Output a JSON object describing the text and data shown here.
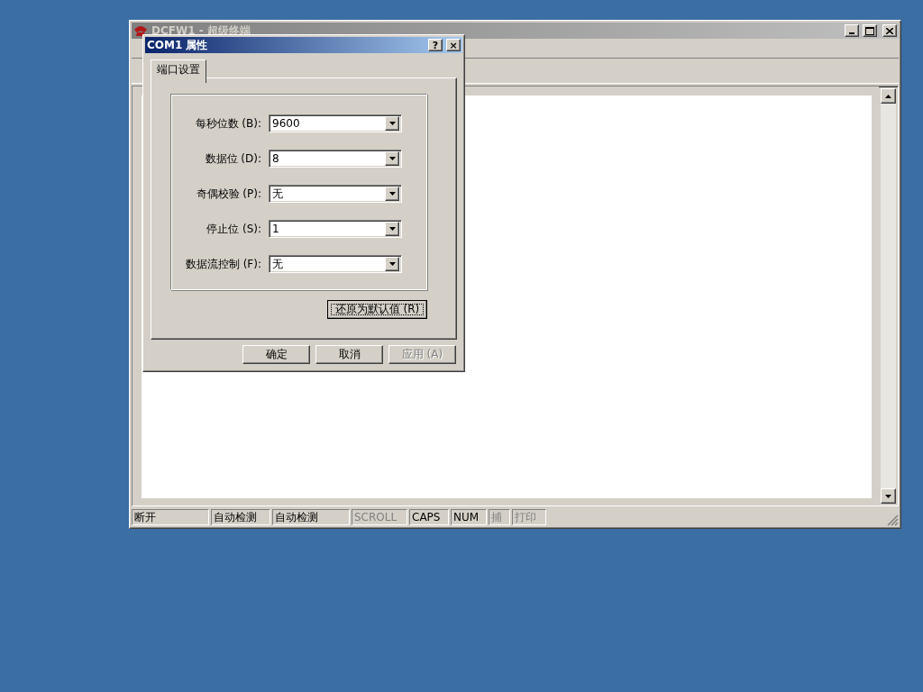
{
  "main_window": {
    "title": "DCFW1 - 超级终端",
    "active": false
  },
  "status_bar": [
    {
      "text": "断开",
      "disabled": false
    },
    {
      "text": "自动检测",
      "disabled": false
    },
    {
      "text": "自动检测",
      "disabled": false
    },
    {
      "text": "SCROLL",
      "disabled": true
    },
    {
      "text": "CAPS",
      "disabled": false
    },
    {
      "text": "NUM",
      "disabled": false
    },
    {
      "text": "捕",
      "disabled": true
    },
    {
      "text": "打印",
      "disabled": true
    }
  ],
  "dialog": {
    "title": "COM1 属性",
    "help_button": "?",
    "close_button": "×",
    "tabs": [
      {
        "label": "端口设置",
        "selected": true
      }
    ],
    "fields": [
      {
        "label": "每秒位数 (B):",
        "value": "9600"
      },
      {
        "label": "数据位 (D):",
        "value": "8"
      },
      {
        "label": "奇偶校验 (P):",
        "value": "无"
      },
      {
        "label": "停止位 (S):",
        "value": "1"
      },
      {
        "label": "数据流控制 (F):",
        "value": "无"
      }
    ],
    "reset_button": {
      "label": "还原为默认值 (R)",
      "focused": true
    },
    "buttons": [
      {
        "label": "确定",
        "disabled": false
      },
      {
        "label": "取消",
        "disabled": false
      },
      {
        "label": "应用 (A)",
        "disabled": true
      }
    ]
  }
}
